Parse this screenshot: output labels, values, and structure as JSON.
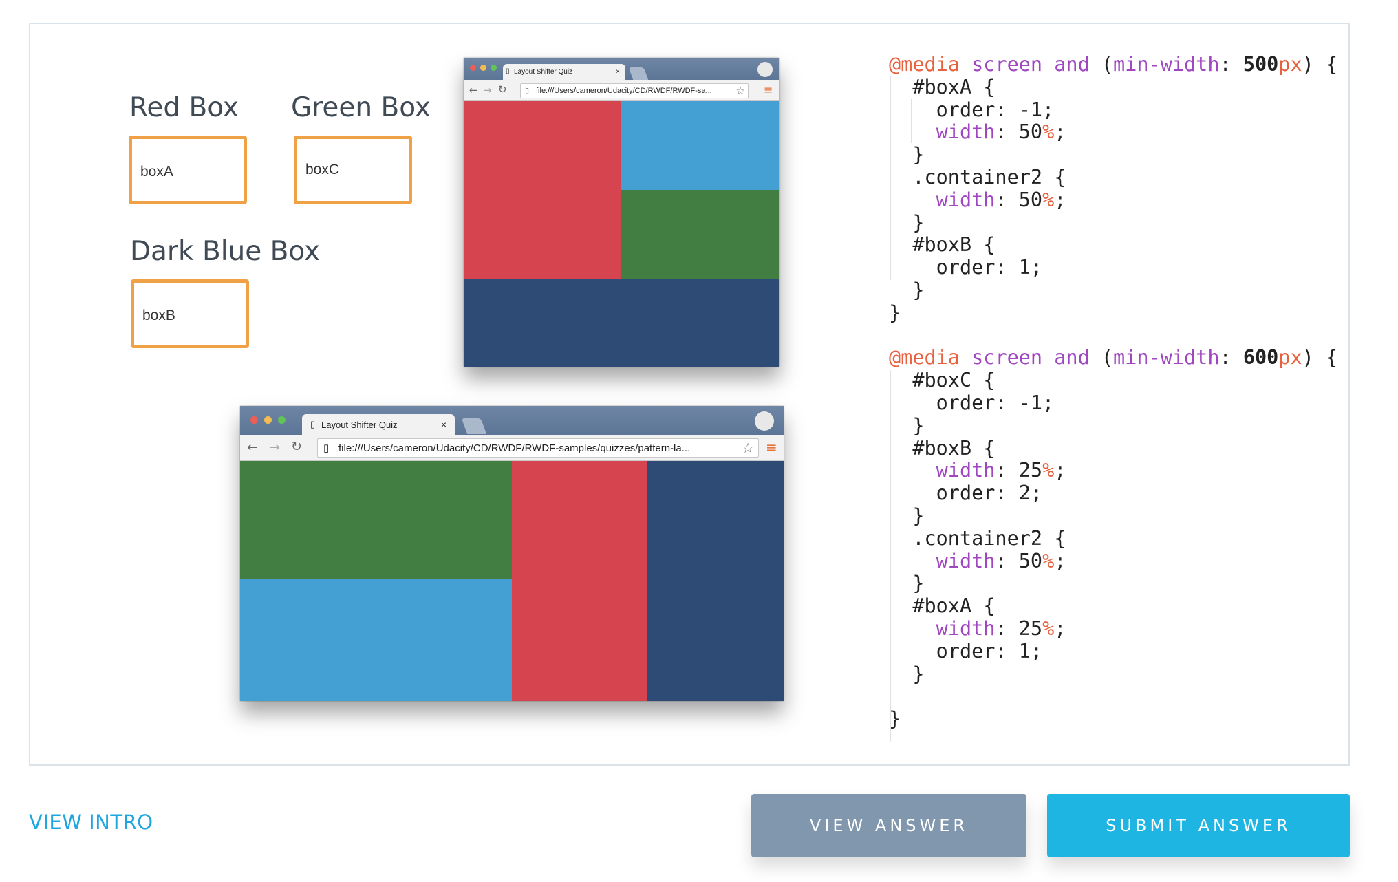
{
  "labels": {
    "red_box": "Red Box",
    "green_box": "Green Box",
    "dark_blue_box": "Dark Blue Box"
  },
  "boxes": {
    "red_value": "boxA",
    "green_value": "boxC",
    "dark_blue_value": "boxB"
  },
  "browser_small": {
    "tab_title": "Layout Shifter Quiz",
    "url": "file:///Users/cameron/Udacity/CD/RWDF/RWDF-sa..."
  },
  "browser_large": {
    "tab_title": "Layout Shifter Quiz",
    "url": "file:///Users/cameron/Udacity/CD/RWDF/RWDF-samples/quizzes/pattern-la..."
  },
  "colors": {
    "red": "#d6454f",
    "green": "#427e42",
    "light_blue": "#44a0d3",
    "dark_blue": "#2e4b75",
    "box_border": "#f0a146",
    "accent": "#1fb5e2",
    "view_answer": "#8197ad"
  },
  "code": {
    "media_1": "@media",
    "screen_and_1": "screen and",
    "min_width_1": "min-width",
    "value_1": "500",
    "unit_1": "px",
    "media_2": "@media",
    "screen_and_2": "screen and",
    "min_width_2": "min-width",
    "value_2": "600",
    "unit_2": "px"
  },
  "footer": {
    "view_intro": "VIEW INTRO",
    "view_answer": "VIEW ANSWER",
    "submit_answer": "SUBMIT ANSWER"
  }
}
